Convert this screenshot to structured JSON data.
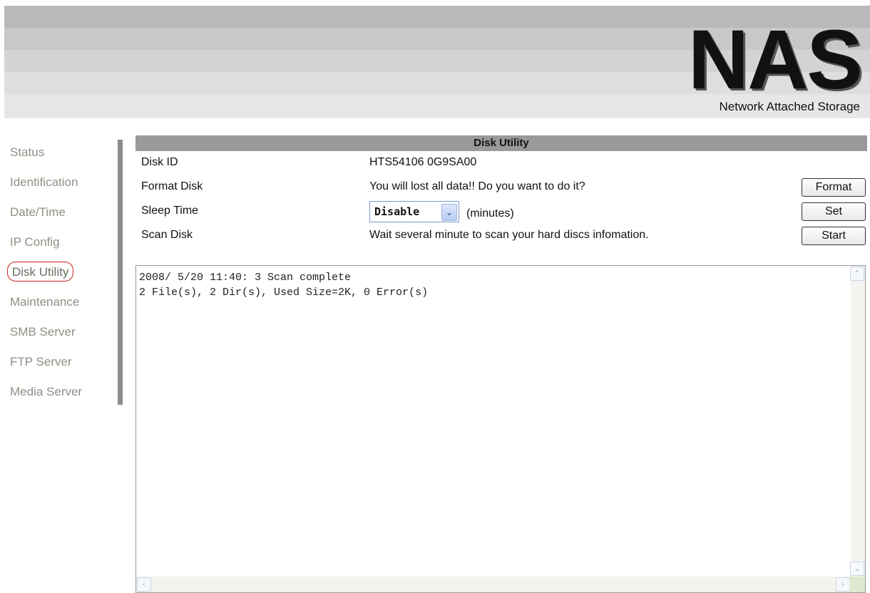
{
  "header": {
    "brand": "NAS",
    "subtitle": "Network Attached Storage"
  },
  "sidebar": {
    "items": [
      {
        "label": "Status"
      },
      {
        "label": "Identification"
      },
      {
        "label": "Date/Time"
      },
      {
        "label": "IP Config"
      },
      {
        "label": "Disk Utility",
        "active": true
      },
      {
        "label": "Maintenance"
      },
      {
        "label": "SMB Server"
      },
      {
        "label": "FTP Server"
      },
      {
        "label": "Media Server"
      }
    ]
  },
  "panel": {
    "title": "Disk Utility",
    "disk_id": {
      "label": "Disk ID",
      "value": "HTS54106 0G9SA00"
    },
    "format": {
      "label": "Format Disk",
      "message": "You will lost all data!! Do you want to do it?",
      "button": "Format"
    },
    "sleep": {
      "label": "Sleep Time",
      "selected": "Disable",
      "units": "(minutes)",
      "button": "Set"
    },
    "scan": {
      "label": "Scan Disk",
      "message": "Wait several minute to scan your hard discs infomation.",
      "button": "Start"
    },
    "log": {
      "line1": "2008/ 5/20 11:40: 3 Scan complete",
      "line2": "2 File(s), 2 Dir(s), Used Size=2K, 0 Error(s)"
    }
  },
  "colors": {
    "title_bar": "#9a9a9a",
    "nav_text": "#8b9283",
    "active_outline": "#cc2222"
  }
}
